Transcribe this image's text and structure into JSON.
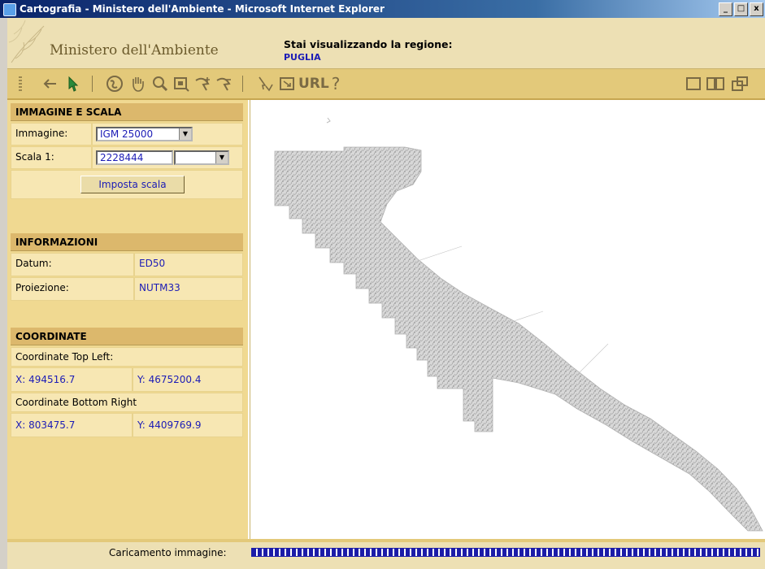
{
  "window": {
    "title": "Cartografia - Ministero dell'Ambiente - Microsoft Internet Explorer",
    "min": "_",
    "max": "□",
    "close": "x"
  },
  "header": {
    "ministry": "Ministero dell'Ambiente",
    "region_label": "Stai visualizzando la regione:",
    "region_name": "PUGLIA"
  },
  "toolbar": {
    "icons": [
      "grip-icon",
      "back-arrow-icon",
      "pointer-icon",
      "globe-icon",
      "pan-hand-icon",
      "zoom-icon",
      "zoom-window-icon",
      "zoom-in-icon",
      "zoom-out-icon",
      "identify-icon",
      "overview-icon",
      "url-icon",
      "help-icon",
      "single-page-icon",
      "two-page-icon",
      "new-window-icon"
    ],
    "url_label": "URL",
    "help_label": "?"
  },
  "sidebar": {
    "image_scale": {
      "header": "IMMAGINE E SCALA",
      "image_label": "Immagine:",
      "image_value": "IGM 25000",
      "scale_label": "Scala 1:",
      "scale_value": "2228444",
      "scale_select_value": "",
      "set_scale_button": "Imposta scala"
    },
    "info": {
      "header": "INFORMAZIONI",
      "datum_label": "Datum:",
      "datum_value": "ED50",
      "projection_label": "Proiezione:",
      "projection_value": "NUTM33"
    },
    "coords": {
      "header": "COORDINATE",
      "top_left_label": "Coordinate Top Left:",
      "top_left_x": "X:  494516.7",
      "top_left_y": "Y:  4675200.4",
      "bottom_right_label": "Coordinate Bottom Right",
      "bottom_right_x": "X:  803475.7",
      "bottom_right_y": "Y:  4409769.9"
    }
  },
  "map": {
    "region": "PUGLIA"
  },
  "status": {
    "loading_label": "Caricamento immagine:",
    "progress": 1.0
  },
  "colors": {
    "panel": "#f0d991",
    "header": "#ede0b4",
    "toolbar": "#e3c97a",
    "section": "#dcb86c",
    "link": "#1c1cb6",
    "progress": "#1c1ca8"
  }
}
